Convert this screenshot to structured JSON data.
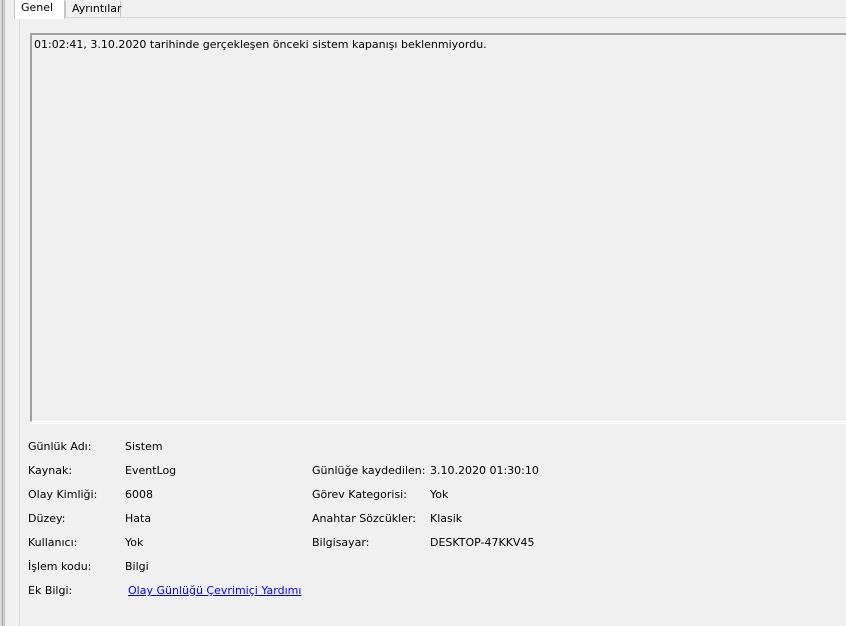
{
  "tabs": [
    "Genel",
    "Ayrıntılar"
  ],
  "description": "01:02:41, 3.10.2020 tarihinde gerçekleşen önceki sistem kapanışı beklenmiyordu.",
  "fields": {
    "log_name_label": "Günlük Adı:",
    "log_name_value": "Sistem",
    "source_label": "Kaynak:",
    "source_value": "EventLog",
    "logged_label": "Günlüğe kaydedilen:",
    "logged_value": "3.10.2020 01:30:10",
    "event_id_label": "Olay Kimliği:",
    "event_id_value": "6008",
    "task_category_label": "Görev Kategorisi:",
    "task_category_value": "Yok",
    "level_label": "Düzey:",
    "level_value": "Hata",
    "keywords_label": "Anahtar Sözcükler:",
    "keywords_value": "Klasik",
    "user_label": "Kullanıcı:",
    "user_value": "Yok",
    "computer_label": "Bilgisayar:",
    "computer_value": "DESKTOP-47KKV45",
    "opcode_label": "İşlem kodu:",
    "opcode_value": "Bilgi",
    "more_info_label": "Ek Bilgi:",
    "more_info_link": "Olay Günlüğü Çevrimiçi Yardımı"
  }
}
